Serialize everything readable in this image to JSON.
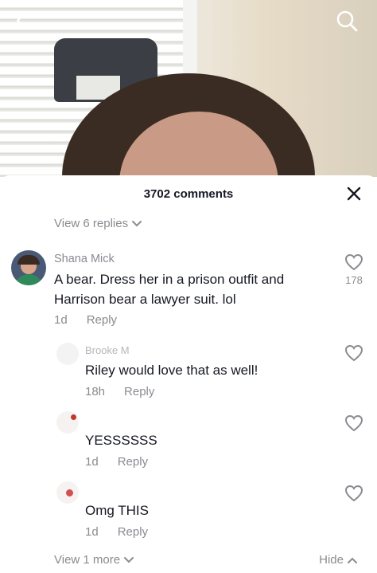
{
  "sheet": {
    "title": "3702 comments"
  },
  "view_replies_top": "View 6 replies",
  "comment": {
    "author": "Shana Mick",
    "text_line1": "A bear. Dress her in a prison outfit and",
    "text_line2": "Harrison bear a lawyer suit. lol",
    "time": "1d",
    "reply": "Reply",
    "likes": "178"
  },
  "replies": [
    {
      "author": "Brooke M",
      "text": "Riley would love that as well!",
      "time": "18h",
      "reply": "Reply"
    },
    {
      "author": "",
      "text": "YESSSSSS",
      "time": "1d",
      "reply": "Reply"
    },
    {
      "author": "",
      "text": "Omg THIS",
      "time": "1d",
      "reply": "Reply"
    }
  ],
  "footer": {
    "view_more": "View 1 more",
    "hide": "Hide"
  },
  "icons": [
    "back-arrow-icon",
    "search-icon",
    "close-icon",
    "heart-icon",
    "chevron-down-icon",
    "chevron-up-icon"
  ]
}
